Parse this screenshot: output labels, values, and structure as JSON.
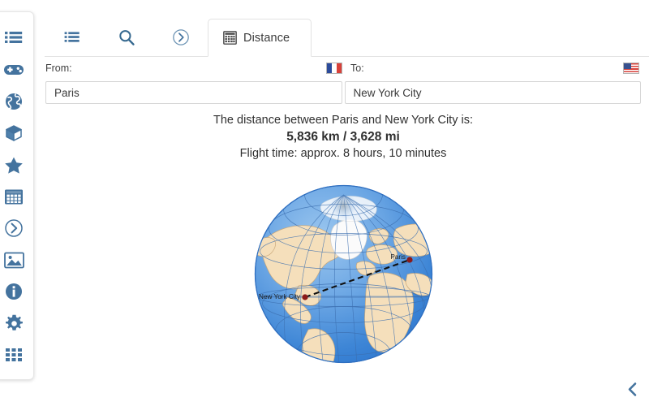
{
  "sidebar": {
    "items": [
      {
        "name": "list-icon",
        "label": "List"
      },
      {
        "name": "gamepad-icon",
        "label": "Games"
      },
      {
        "name": "globe-icon",
        "label": "Globe"
      },
      {
        "name": "cube-icon",
        "label": "Cube"
      },
      {
        "name": "star-icon",
        "label": "Favorites"
      },
      {
        "name": "table-icon",
        "label": "Table"
      },
      {
        "name": "clock-circle-icon",
        "label": "History"
      },
      {
        "name": "image-icon",
        "label": "Images"
      },
      {
        "name": "info-icon",
        "label": "Info"
      },
      {
        "name": "gear-icon",
        "label": "Settings"
      },
      {
        "name": "apps-grid-icon",
        "label": "Apps"
      }
    ]
  },
  "tabs": [
    {
      "id": "list",
      "icon": "list-icon",
      "label": "",
      "active": false
    },
    {
      "id": "search",
      "icon": "search-icon",
      "label": "",
      "active": false
    },
    {
      "id": "history",
      "icon": "clock-circle-icon",
      "label": "",
      "active": false
    },
    {
      "id": "distance",
      "icon": "calculator-icon",
      "label": "Distance",
      "active": true
    }
  ],
  "form": {
    "from_label": "From:",
    "to_label": "To:",
    "from_flag": "flag-france",
    "to_flag": "flag-united-states",
    "from_value": "Paris",
    "to_value": "New York City",
    "from_placeholder": "",
    "to_placeholder": ""
  },
  "result": {
    "line1": "The distance between Paris and New York City is:",
    "line2": "5,836 km / 3,628 mi",
    "line3": "Flight time: approx. 8 hours, 10 minutes"
  },
  "map": {
    "origin_label": "Paris",
    "destination_label": "New York City",
    "route_style": "dashed",
    "marker_color": "#8b1a1a",
    "ocean_color": "#4f94e0",
    "land_color": "#f5dfbb",
    "graticule_color": "#3c6fb0"
  },
  "footer": {
    "collapse_icon": "chevron-left-icon"
  },
  "colors": {
    "accent": "#44739e",
    "tab_border": "#e2e2e2",
    "text": "#2f2f2f",
    "input_border": "#d6d6d6"
  }
}
